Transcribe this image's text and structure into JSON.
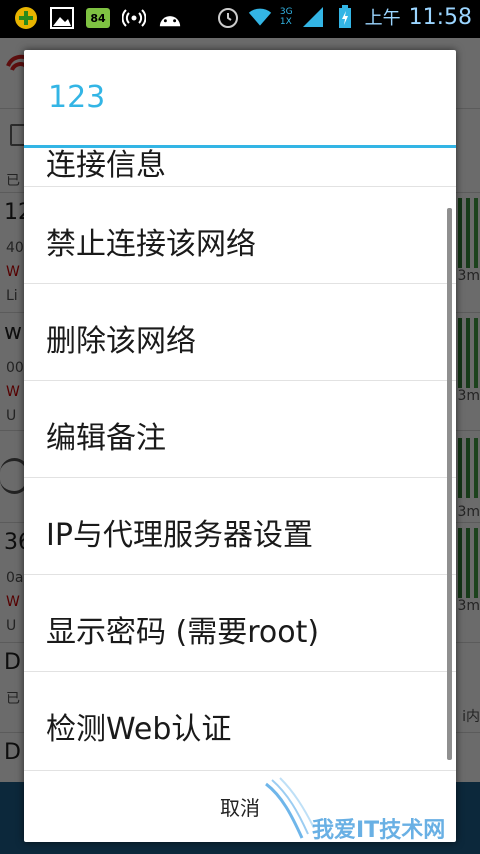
{
  "status_bar": {
    "battery_level": "84",
    "am_pm": "上午",
    "time": "11:58",
    "net_up": "3G",
    "net_down": "1X"
  },
  "dialog": {
    "title": "123",
    "partial_item": "连接信息",
    "items": [
      {
        "label": "禁止连接该网络"
      },
      {
        "label": "删除该网络"
      },
      {
        "label": "编辑备注"
      },
      {
        "label": "IP与代理服务器设置"
      },
      {
        "label": "显示密码 (需要root)"
      },
      {
        "label": "检测Web认证"
      }
    ],
    "cancel_label": "取消"
  },
  "background": {
    "row_texts": [
      "已",
      "12",
      "40",
      "W",
      "Li",
      "w",
      "00",
      "W",
      "U",
      "36",
      "0a",
      "W",
      "U",
      "D",
      "已",
      "D"
    ],
    "right_texts": [
      "3m",
      "3m",
      "3m",
      "3m",
      "3m",
      "i内"
    ]
  },
  "watermark": {
    "text": "我爱IT技术网"
  },
  "colors": {
    "accent": "#33b5e5",
    "status_bar_bg": "#000000"
  }
}
